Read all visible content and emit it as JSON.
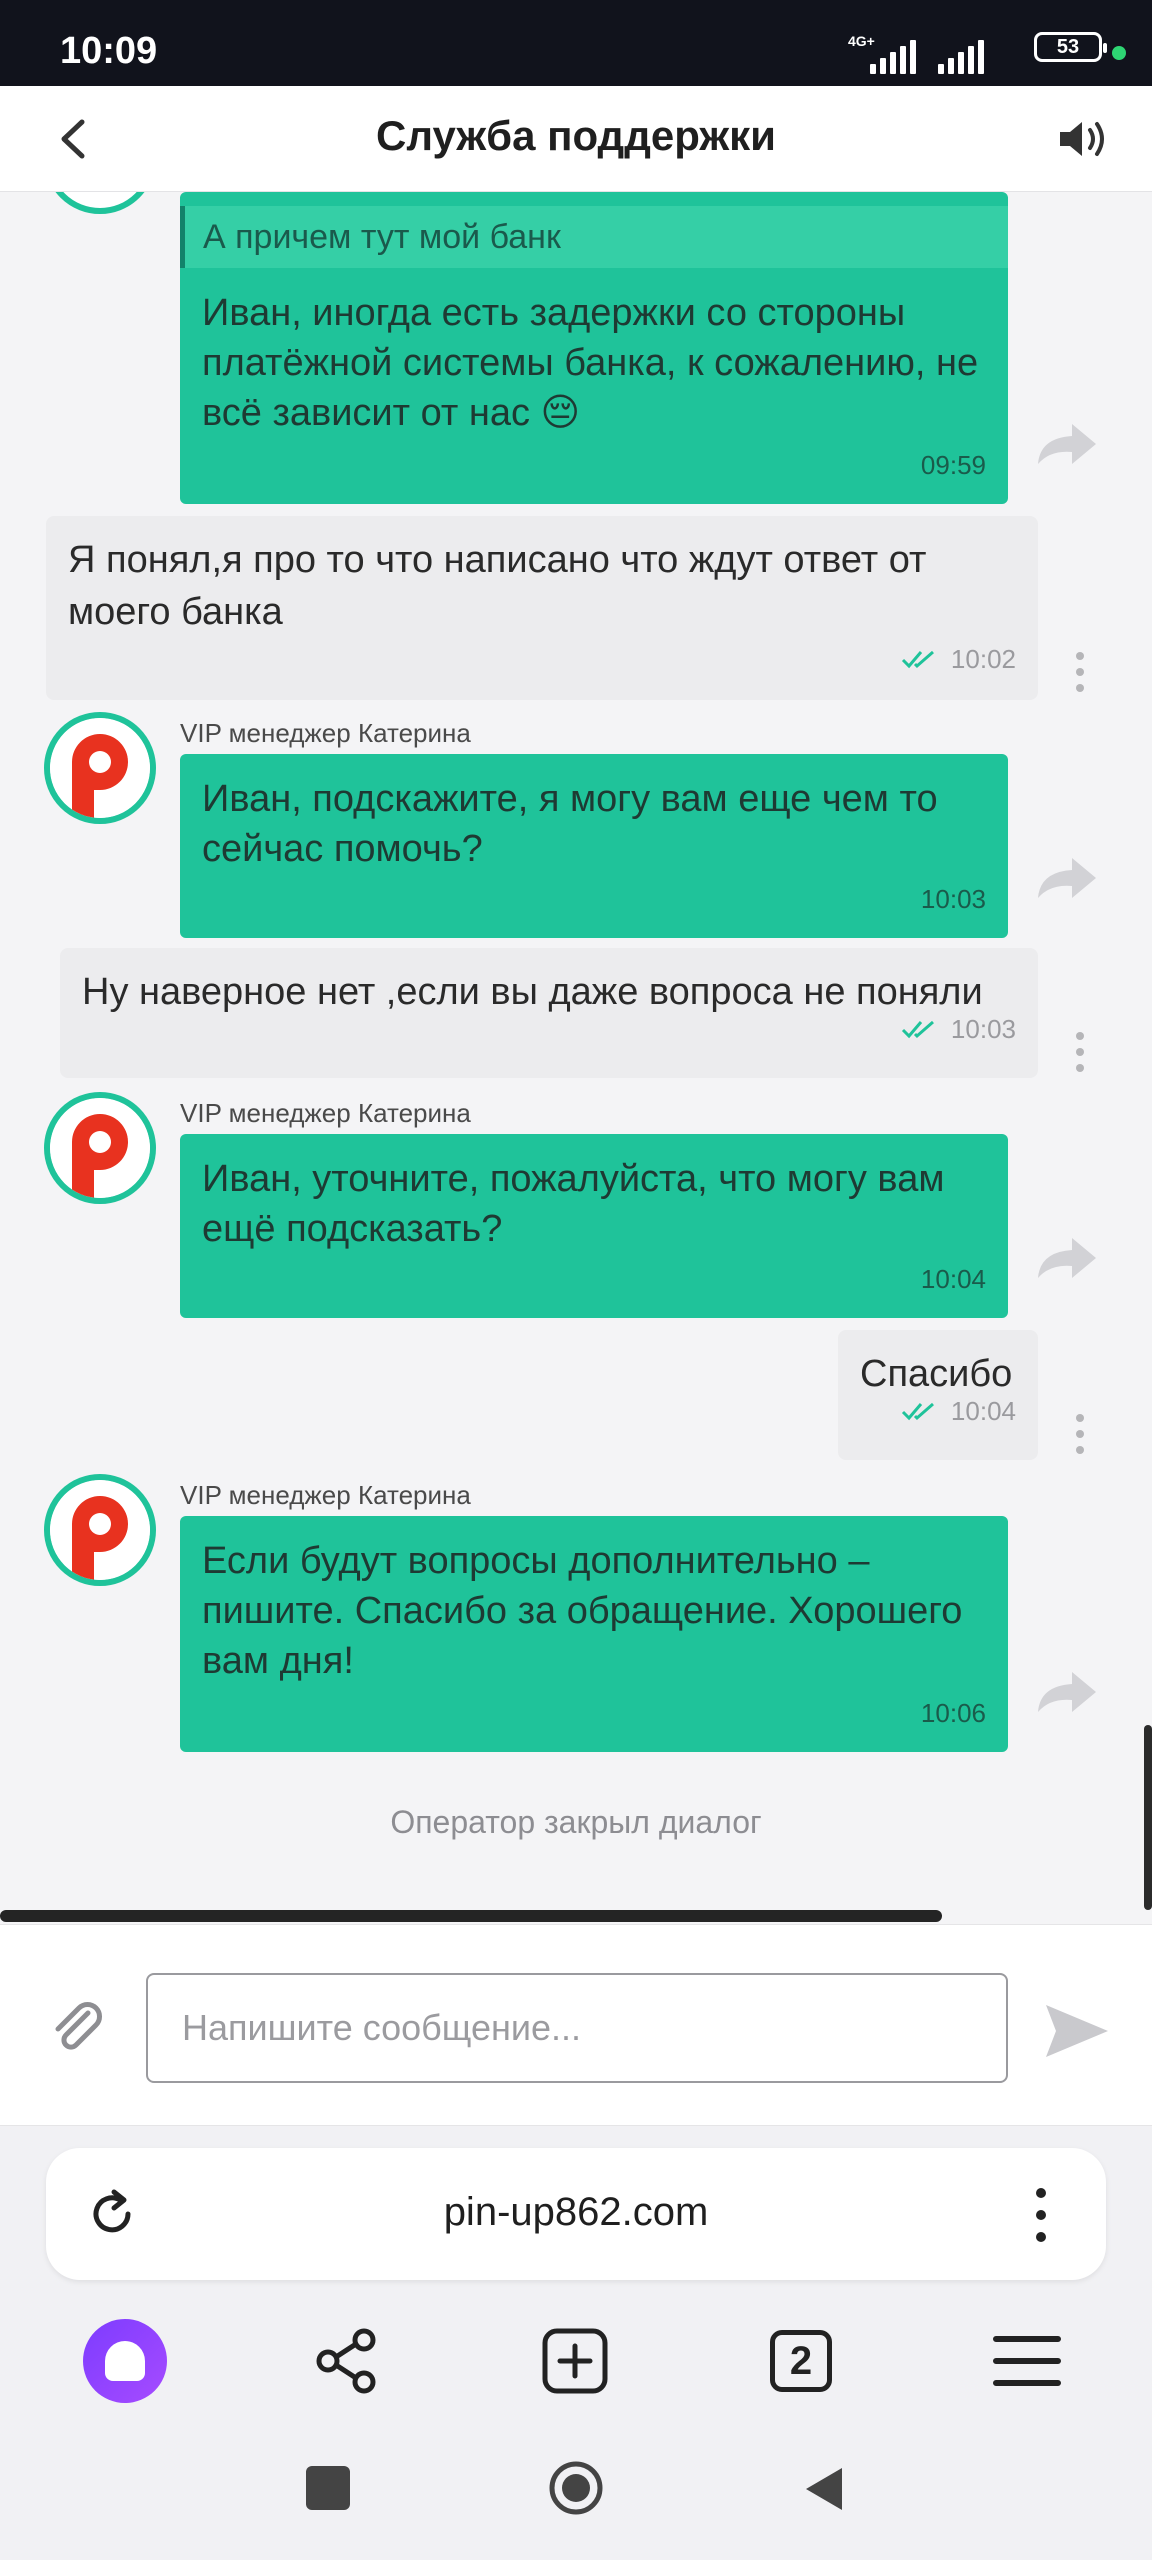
{
  "status": {
    "time": "10:09",
    "network": "4G+",
    "battery": "53"
  },
  "header": {
    "title": "Служба поддержки",
    "back_icon": "chevron-left-icon",
    "sound_icon": "speaker-icon"
  },
  "chat": {
    "messages": [
      {
        "type": "operator",
        "quote": "А причем тут мой банк",
        "text": "Иван, иногда есть задержки со стороны платёжной системы банка, к сожалению, не всё зависит от нас 😔",
        "time": "09:59"
      },
      {
        "type": "user",
        "text": "Я понял,я про то что написано что ждут ответ от моего банка",
        "time": "10:02"
      },
      {
        "type": "operator",
        "sender": "VIP менеджер Катерина",
        "text": "Иван, подскажите, я могу вам еще чем то сейчас помочь?",
        "time": "10:03"
      },
      {
        "type": "user",
        "text": "Ну наверное нет ,если вы даже вопроса не поняли",
        "time": "10:03"
      },
      {
        "type": "operator",
        "sender": "VIP менеджер Катерина",
        "text": "Иван, уточните, пожалуйста, что могу вам ещё подсказать?",
        "time": "10:04"
      },
      {
        "type": "user",
        "text": "Спасибо",
        "time": "10:04"
      },
      {
        "type": "operator",
        "sender": "VIP менеджер Катерина",
        "text": "Если будут вопросы дополнительно – пишите. Спасибо за обращение. Хорошего вам дня!",
        "time": "10:06"
      }
    ],
    "closed_notice": "Оператор закрыл диалог"
  },
  "composer": {
    "placeholder": "Напишите сообщение..."
  },
  "browser": {
    "url": "pin-up862.com",
    "tab_count": "2"
  },
  "colors": {
    "operator_bubble": "#1fc39a",
    "user_bubble": "#ececee",
    "brand_red": "#e8321f",
    "tick": "#1fc39a"
  }
}
